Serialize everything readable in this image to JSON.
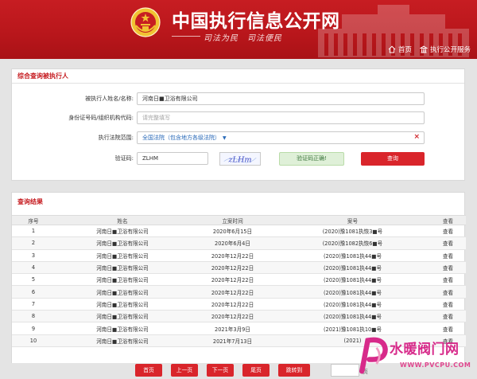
{
  "header": {
    "site_title": "中国执行信息公开网",
    "slogan": "司法为民　司法便民",
    "nav": [
      {
        "label": "首页",
        "icon": "home-icon"
      },
      {
        "label": "执行公开服务",
        "icon": "building-icon"
      }
    ]
  },
  "query_panel": {
    "title": "综合查询被执行人",
    "name_label": "被执行人姓名/名称:",
    "name_value": "河南日■卫浴有限公司",
    "id_label": "身份证号码/组织机构代码:",
    "id_placeholder": "请完整填写",
    "court_label": "执行法院范围:",
    "court_value": "全国法院（包含地方各级法院）",
    "code_label": "验证码:",
    "code_value": "ZLHM",
    "captcha_text": "zLHm",
    "verify_status": "验证码正确!",
    "submit_label": "查询"
  },
  "results": {
    "title": "查询结果",
    "columns": [
      "序号",
      "姓名",
      "立案时间",
      "案号",
      "查看"
    ],
    "rows": [
      {
        "no": "1",
        "name": "河南日■卫浴有限公司",
        "date": "2020年6月15日",
        "case": "(2020)豫1081执恢3■号",
        "view": "查看"
      },
      {
        "no": "2",
        "name": "河南日■卫浴有限公司",
        "date": "2020年6月4日",
        "case": "(2020)豫1082执恢6■号",
        "view": "查看"
      },
      {
        "no": "3",
        "name": "河南日■卫浴有限公司",
        "date": "2020年12月22日",
        "case": "(2020)豫1081执44■号",
        "view": "查看"
      },
      {
        "no": "4",
        "name": "河南日■卫浴有限公司",
        "date": "2020年12月22日",
        "case": "(2020)豫1081执44■号",
        "view": "查看"
      },
      {
        "no": "5",
        "name": "河南日■卫浴有限公司",
        "date": "2020年12月22日",
        "case": "(2020)豫1081执44■号",
        "view": "查看"
      },
      {
        "no": "6",
        "name": "河南日■卫浴有限公司",
        "date": "2020年12月22日",
        "case": "(2020)豫1081执44■号",
        "view": "查看"
      },
      {
        "no": "7",
        "name": "河南日■卫浴有限公司",
        "date": "2020年12月22日",
        "case": "(2020)豫1081执44■号",
        "view": "查看"
      },
      {
        "no": "8",
        "name": "河南日■卫浴有限公司",
        "date": "2020年12月22日",
        "case": "(2020)豫1081执44■号",
        "view": "查看"
      },
      {
        "no": "9",
        "name": "河南日■卫浴有限公司",
        "date": "2021年3月9日",
        "case": "(2021)豫1081执10■号",
        "view": "查看"
      },
      {
        "no": "10",
        "name": "河南日■卫浴有限公司",
        "date": "2021年7月13日",
        "case": "(2021)",
        "view": "查看"
      }
    ]
  },
  "pagination": {
    "first": "首页",
    "prev": "上一页",
    "next": "下一页",
    "last": "尾页",
    "goto": "跳转到",
    "suffix": "页"
  },
  "watermark": {
    "title": "水暖阀门网",
    "url": "WWW.PVCPU.COM"
  },
  "colors": {
    "brand_red": "#c71d22",
    "link_blue": "#2a6ab8",
    "success_green": "#3c763d"
  }
}
